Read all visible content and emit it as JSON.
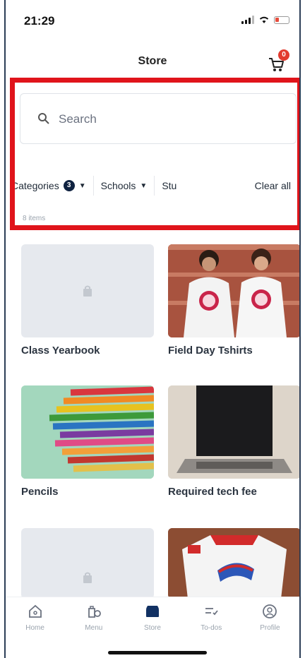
{
  "status_bar": {
    "time": "21:29"
  },
  "header": {
    "title": "Store",
    "cart_count": "0"
  },
  "search": {
    "placeholder": "Search"
  },
  "filters": {
    "categories": {
      "label": "Categories",
      "count": "3"
    },
    "schools": {
      "label": "Schools"
    },
    "students": {
      "label": "Stu"
    },
    "clear_all": "Clear all"
  },
  "items_count": "8 items",
  "products": [
    {
      "name": "Class Yearbook",
      "image": "placeholder"
    },
    {
      "name": "Field Day Tshirts",
      "image": "photo"
    },
    {
      "name": "Pencils",
      "image": "photo"
    },
    {
      "name": "Required tech fee",
      "image": "photo"
    }
  ],
  "bottom_nav": [
    {
      "label": "Home",
      "icon": "home-icon"
    },
    {
      "label": "Menu",
      "icon": "menu-icon"
    },
    {
      "label": "Store",
      "icon": "store-icon",
      "active": true
    },
    {
      "label": "To-dos",
      "icon": "todo-icon"
    },
    {
      "label": "Profile",
      "icon": "profile-icon"
    }
  ],
  "colors": {
    "highlight": "#e0141b",
    "badge": "#0f2240",
    "cart_badge": "#e23b2e"
  }
}
